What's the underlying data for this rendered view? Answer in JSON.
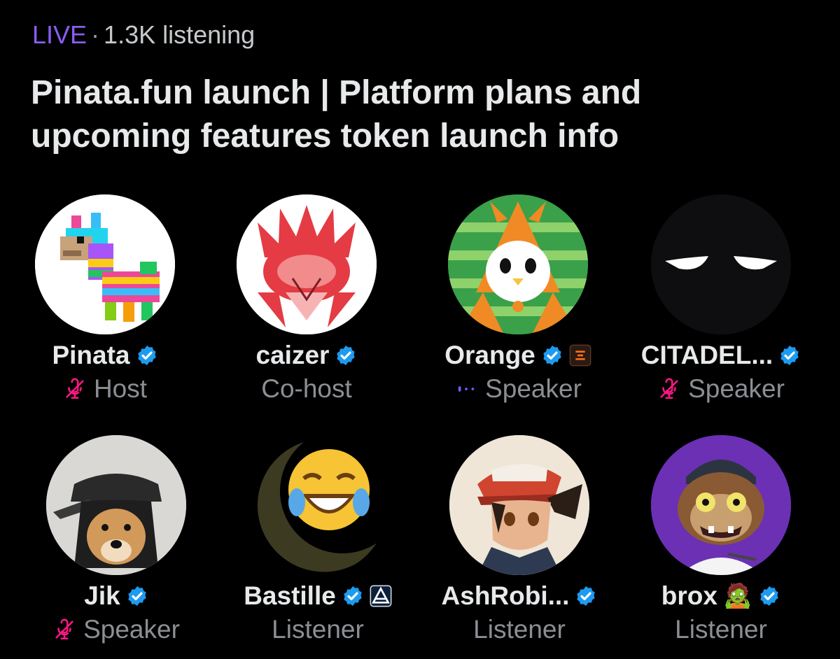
{
  "space": {
    "live_label": "LIVE",
    "separator": "·",
    "listening": "1.3K listening",
    "title": "Pinata.fun launch | Platform plans and upcoming features token launch info"
  },
  "colors": {
    "live": "#8b5cf6",
    "verified": "#1d9bf0",
    "muted_mic": "#f91880",
    "speaking": "#7856ff",
    "role_text": "#8b8f94"
  },
  "participants": [
    {
      "name": "Pinata",
      "role": "Host",
      "verified": true,
      "status_icon": "muted-mic-icon",
      "avatar": "pixel-llama-pinata-avatar"
    },
    {
      "name": "caizer",
      "role": "Co-host",
      "verified": true,
      "status_icon": "",
      "avatar": "red-phoenix-avatar"
    },
    {
      "name": "Orange",
      "role": "Speaker",
      "verified": true,
      "status_icon": "speaking-dots-icon",
      "affiliate_icon": "orange-affiliate-badge",
      "avatar": "penguin-charizard-costume-avatar"
    },
    {
      "name": "CITADEL...",
      "role": "Speaker",
      "verified": true,
      "status_icon": "muted-mic-icon",
      "avatar": "glowing-eyes-avatar"
    },
    {
      "name": "Jik",
      "role": "Speaker",
      "verified": true,
      "status_icon": "muted-mic-icon",
      "avatar": "dog-in-cap-avatar"
    },
    {
      "name": "Bastille",
      "role": "Listener",
      "verified": true,
      "status_icon": "",
      "affiliate_icon": "triangle-affiliate-badge",
      "avatar": "laughing-emoji-crescent-avatar"
    },
    {
      "name": "AshRobi...",
      "role": "Listener",
      "verified": true,
      "status_icon": "",
      "avatar": "anime-trainer-avatar"
    },
    {
      "name": "brox",
      "role": "Listener",
      "verified": true,
      "status_icon": "",
      "emoji": "🧟",
      "avatar": "zombie-monkey-avatar"
    }
  ]
}
